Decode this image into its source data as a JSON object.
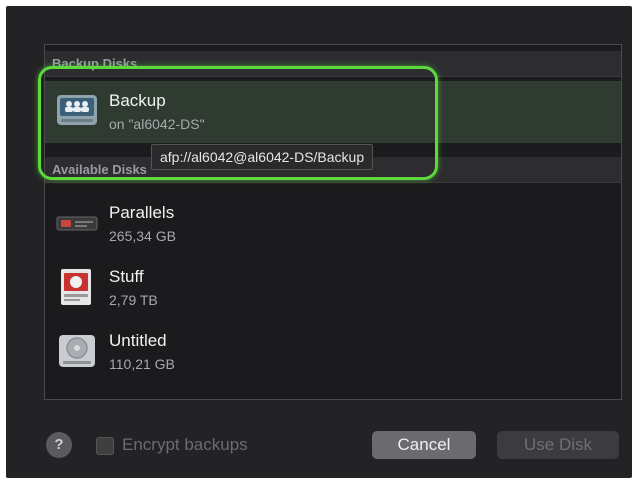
{
  "sections": {
    "backup_disks": "Backup Disks",
    "available_disks": "Available Disks"
  },
  "backup_disk": {
    "name": "Backup",
    "location": "on \"al6042-DS\"",
    "icon": "network-server-icon",
    "tooltip": "afp://al6042@al6042-DS/Backup"
  },
  "available_disks": [
    {
      "name": "Parallels",
      "size": "265,34 GB",
      "icon": "external-drive-icon"
    },
    {
      "name": "Stuff",
      "size": "2,79 TB",
      "icon": "hard-disk-red-icon"
    },
    {
      "name": "Untitled",
      "size": "110,21 GB",
      "icon": "internal-disk-icon"
    }
  ],
  "footer": {
    "help_label": "?",
    "encrypt_label": "Encrypt backups",
    "cancel_label": "Cancel",
    "use_disk_label": "Use Disk"
  },
  "colors": {
    "highlight": "#5bd93d",
    "dialog_bg": "#232325"
  }
}
